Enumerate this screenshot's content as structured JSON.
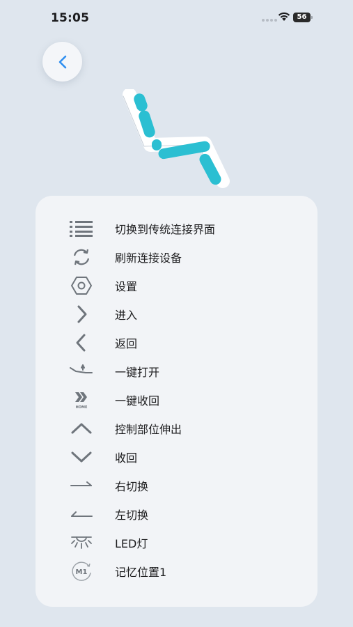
{
  "status_bar": {
    "time": "15:05",
    "battery": "56",
    "icons": [
      "cellular-dots-icon",
      "wifi-icon",
      "battery-icon"
    ]
  },
  "navigation": {
    "back_icon": "chevron-left-icon"
  },
  "colors": {
    "accent": "#2e8ef0",
    "chair_segment": "#2bbfd2",
    "icon_gray": "#6f757c",
    "background": "#dfe6ee",
    "card": "#f2f4f7"
  },
  "legend": {
    "items": [
      {
        "icon": "list-icon",
        "label": "切换到传统连接界面"
      },
      {
        "icon": "refresh-icon",
        "label": "刷新连接设备"
      },
      {
        "icon": "hexagon-nut-icon",
        "label": "设置"
      },
      {
        "icon": "chevron-right-icon",
        "label": "进入"
      },
      {
        "icon": "chevron-left-icon",
        "label": "返回"
      },
      {
        "icon": "chair-open-icon",
        "label": "一键打开"
      },
      {
        "icon": "home-return-icon",
        "icon_text": "HOME",
        "label": "一键收回"
      },
      {
        "icon": "chevron-up-icon",
        "label": "控制部位伸出"
      },
      {
        "icon": "chevron-down-icon",
        "label": "收回"
      },
      {
        "icon": "arrow-right-switch-icon",
        "label": "右切换"
      },
      {
        "icon": "arrow-left-switch-icon",
        "label": "左切换"
      },
      {
        "icon": "led-light-icon",
        "label": "LED灯"
      },
      {
        "icon": "memory-m1-icon",
        "icon_text": "M1",
        "label": "记忆位置1"
      }
    ]
  }
}
